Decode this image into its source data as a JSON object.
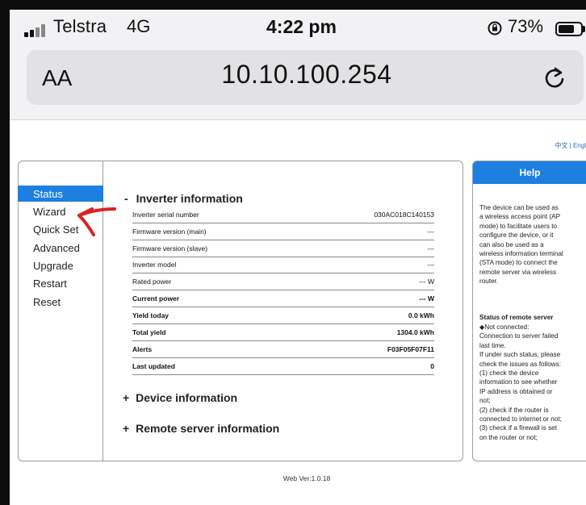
{
  "status_bar": {
    "carrier": "Telstra",
    "network": "4G",
    "time": "4:22 pm",
    "battery": "73%",
    "battery_level": 0.73
  },
  "browser": {
    "text_size_label": "AA",
    "url": "10.10.100.254"
  },
  "page": {
    "language_links": "中文 | Engl"
  },
  "nav": {
    "items": [
      "Status",
      "Wizard",
      "Quick Set",
      "Advanced",
      "Upgrade",
      "Restart",
      "Reset"
    ],
    "active": "Status"
  },
  "inverter": {
    "title": "Inverter information",
    "expander": "-",
    "rows": [
      {
        "label": "Inverter serial number",
        "value": "030AC018C140153"
      },
      {
        "label": "Firmware version (main)",
        "value": "---"
      },
      {
        "label": "Firmware version (slave)",
        "value": "---"
      },
      {
        "label": "Inverter model",
        "value": "---"
      },
      {
        "label": "Rated power",
        "value": "--- W"
      },
      {
        "label": "Current power",
        "value": "--- W"
      },
      {
        "label": "Yield today",
        "value": "0.0 kWh"
      },
      {
        "label": "Total yield",
        "value": "1304.0 kWh"
      },
      {
        "label": "Alerts",
        "value": "F03F05F07F11"
      },
      {
        "label": "Last updated",
        "value": "0"
      }
    ]
  },
  "sections": {
    "device": {
      "expander": "+",
      "title": "Device information"
    },
    "remote": {
      "expander": "+",
      "title": "Remote server information"
    }
  },
  "footer": {
    "version": "Web Ver:1.0.18"
  },
  "help": {
    "title": "Help",
    "intro": [
      "The device can be used as",
      "a wireless access point (AP",
      "mode) to facilitate users to",
      "configure the device, or it",
      "can also be used as a",
      "wireless information terminal",
      "(STA mode) to connect the",
      "remote server via wireless",
      "router."
    ],
    "status_title": "Status of remote server",
    "status_lines": [
      "◆Not connected:",
      "Connection to server failed",
      "last time.",
      "If under such status, please",
      "check the issues as follows:",
      "(1) check the device",
      "information to see whether",
      "IP address is obtained or",
      "not;",
      "(2) check if the router is",
      "connected to internet or not;",
      "(3) check if a firewall is set",
      "on the router or not;"
    ]
  },
  "colors": {
    "accent": "#1d7fe0",
    "arrow": "#e02020",
    "browser_chrome": "#f2f2f4"
  },
  "icons": [
    "signal-bars-icon",
    "rotation-lock-icon",
    "battery-icon",
    "reload-icon",
    "arrow-annotation-icon"
  ]
}
